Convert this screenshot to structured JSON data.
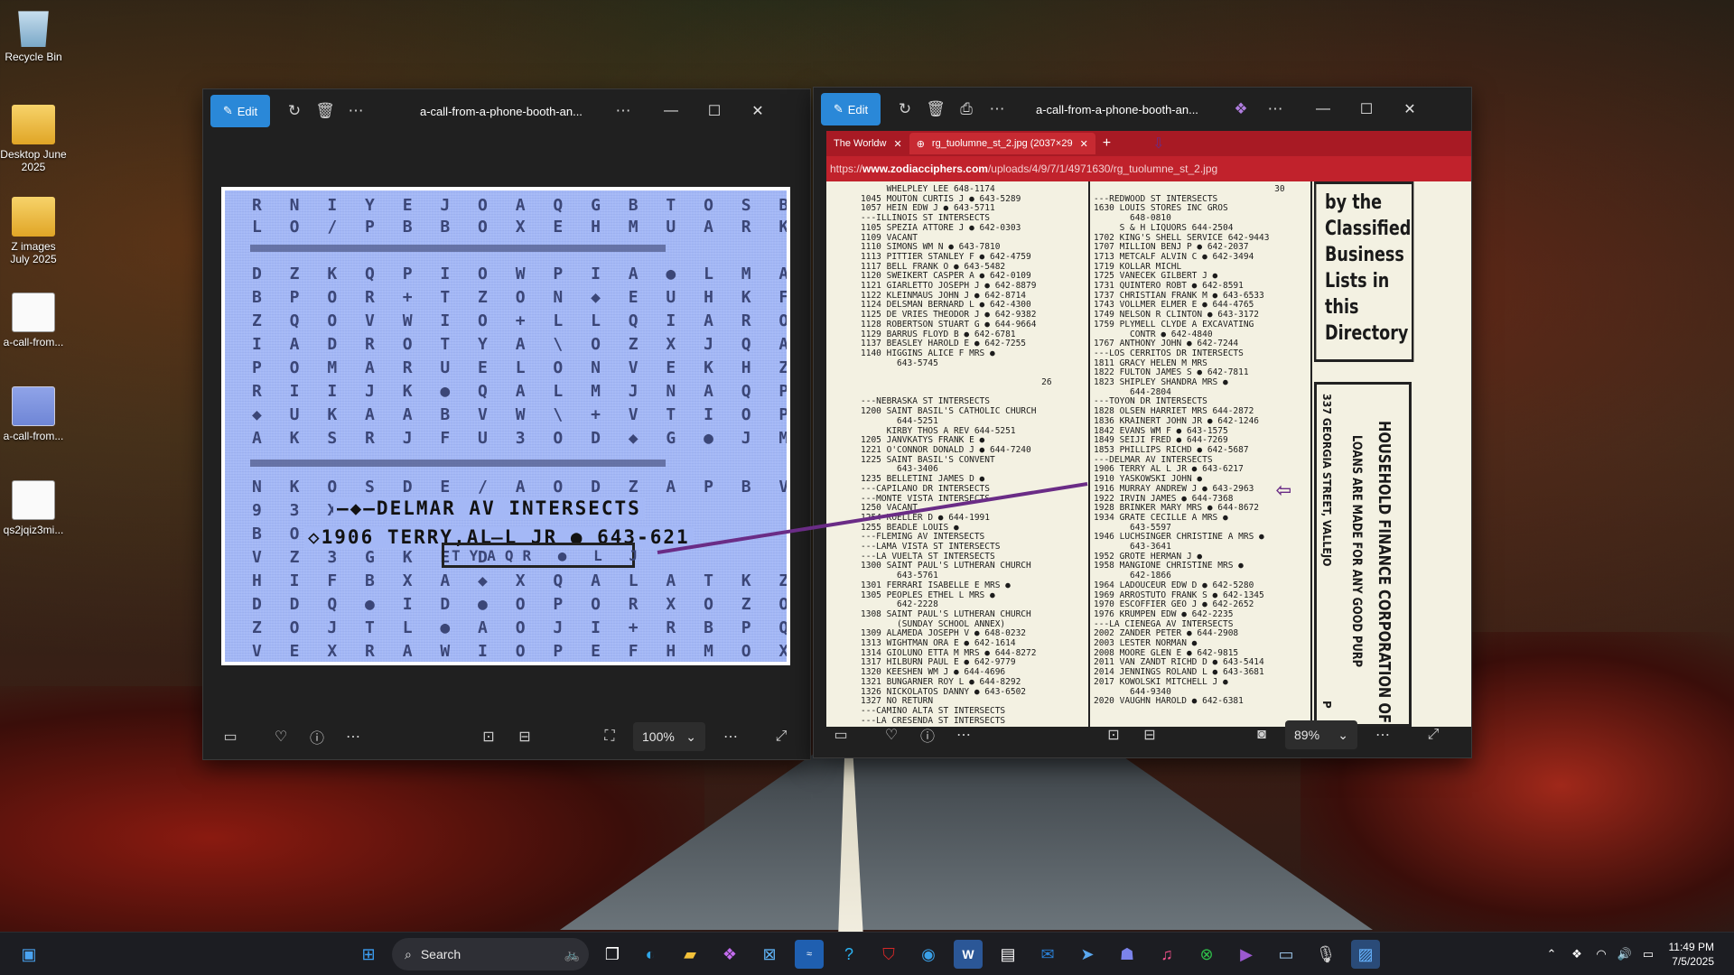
{
  "desktop": {
    "icons": [
      {
        "label": "Recycle Bin"
      },
      {
        "label": "Desktop June 2025"
      },
      {
        "label": "Z images July 2025"
      },
      {
        "label": "a-call-from..."
      },
      {
        "label": "a-call-from..."
      },
      {
        "label": "qs2jqiz3mi..."
      }
    ]
  },
  "left_window": {
    "edit_label": "Edit",
    "title": "a-call-from-a-phone-booth-an...",
    "zoom": "100%",
    "image": {
      "cipher_rows_top": [
        "R N I Y E J O A Q G B T O S B",
        "L O / P B B O X E H M U A R K",
        "D Z K Q P I O W P I A ● L M A A",
        "B P O R + T Z O N ◆ E U H K F",
        "Z Q O V W I O + L L Q I A R O H",
        "I A D R O T Y A \\ O Z X J Q A",
        "P O M A R U E L O N V E K H Z",
        "R I I J K ● Q A L M J N A Q P",
        "◆ U K A A B V W \\ + V T I O P",
        "A K S R J F U 3 O D ◆ G ● J M"
      ],
      "cipher_rows_bottom": [
        "N K O S D E / A O D Z A P B V",
        "9 3 X L",
        "B O T",
        "V Z 3 G K E D",
        "H I F B X A ◆ X Q A L A T K Z",
        "D D Q ● I D ● O P O R X O Z O",
        "Z O J T L ● A O J I + R B P Q W",
        "V E X R A W I O P E F H M O X U I K"
      ],
      "overlay_line_1": "—◆—DELMAR AV INTERSECTS",
      "overlay_line_2": "◇1906 TERRY,AL̶L JR ● 643-621",
      "highlight_text": "TYAQR ● L J"
    }
  },
  "right_window": {
    "edit_label": "Edit",
    "title": "a-call-from-a-phone-booth-an...",
    "zoom": "89%",
    "browser": {
      "tabs": [
        {
          "label": "The Worldw"
        },
        {
          "label": "rg_tuolumne_st_2.jpg (2037×29"
        }
      ],
      "url_prefix": "https://",
      "url_domain": "www.zodiacciphers.com",
      "url_path": "/uploads/4/9/7/1/4971630/rg_tuolumne_st_2.jpg",
      "directory": {
        "col1": "     WHELPLEY LEE 648-1174\n1045 MOUTON CURTIS J ● 643-5289\n1057 HEIN EDW J ● 643-5711\n---ILLINOIS ST INTERSECTS\n1105 SPEZIA ATTORE J ● 642-0303\n1109 VACANT\n1110 SIMONS WM N ● 643-7810\n1113 PITTIER STANLEY F ● 642-4759\n1117 BELL FRANK O ● 643-5482\n1120 SWEIKERT CASPER A ● 642-0109\n1121 GIARLETTO JOSEPH J ● 642-8879\n1122 KLEINMAUS JOHN J ● 642-8714\n1124 DELSMAN BERNARD L ● 642-4300\n1125 DE VRIES THEODOR J ● 642-9382\n1128 ROBERTSON STUART G ● 644-9664\n1129 BARRUS FLOYD B ● 642-6781\n1137 BEASLEY HAROLD E ● 642-7255\n1140 HIGGINS ALICE F MRS ●\n       643-5745\n\n                                   26\n\n---NEBRASKA ST INTERSECTS\n1200 SAINT BASIL'S CATHOLIC CHURCH\n       644-5251\n     KIRBY THOS A REV 644-5251\n1205 JANVKATYS FRANK E ●\n1221 O'CONNOR DONALD J ● 644-7240\n1225 SAINT BASIL'S CONVENT\n       643-3406\n1235 BELLETINI JAMES D ●\n---CAPILANO DR INTERSECTS\n---MONTE VISTA INTERSECTS\n1250 VACANT\n1254 KOELLER D ● 644-1991\n1255 BEADLE LOUIS ●\n---FLEMING AV INTERSECTS\n---LAMA VISTA ST INTERSECTS\n---LA VUELTA ST INTERSECTS\n1300 SAINT PAUL'S LUTHERAN CHURCH\n       643-5761\n1301 FERRARI ISABELLE E MRS ●\n1305 PEOPLES ETHEL L MRS ●\n       642-2228\n1308 SAINT PAUL'S LUTHERAN CHURCH\n       (SUNDAY SCHOOL ANNEX)\n1309 ALAMEDA JOSEPH V ● 648-0232\n1313 WIGHTMAN ORA E ● 642-1614\n1314 GIOLUNO ETTA M MRS ● 644-8272\n1317 HILBURN PAUL E ● 642-9779\n1320 KEESHEN WM J ● 644-4696\n1321 BUNGARNER ROY L ● 644-8292\n1326 NICKOLATOS DANNY ● 643-6502\n1327 NO RETURN\n---CAMINO ALTA ST INTERSECTS\n---LA CRESENDA ST INTERSECTS",
        "col2": "                                   30\n---REDWOOD ST INTERSECTS\n1630 LOUIS STORES INC GROS\n       648-0810\n     S & H LIQUORS 644-2504\n1702 KING'S SHELL SERVICE 642-9443\n1707 MILLION BENJ P ● 642-2037\n1713 METCALF ALVIN C ● 642-3494\n1719 KOLLAR MICHL\n1725 VANECEK GILBERT J ●\n1731 QUINTERO ROBT ● 642-8591\n1737 CHRISTIAN FRANK M ● 643-6533\n1743 VOLLMER ELMER E ● 644-4765\n1749 NELSON R CLINTON ● 643-3172\n1759 PLYMELL CLYDE A EXCAVATING\n       CONTR ● 642-4840\n1767 ANTHONY JOHN ● 642-7244\n---LOS CERRITOS DR INTERSECTS\n1811 GRACY HELEN M MRS\n1822 FULTON JAMES S ● 642-7811\n1823 SHIPLEY SHANDRA MRS ●\n       644-2804\n---TOYON DR INTERSECTS\n1828 OLSEN HARRIET MRS 644-2872\n1836 KRAINERT JOHN JR ● 642-1246\n1842 EVANS WM F ● 643-1575\n1849 SEIJI FRED ● 644-7269\n1853 PHILLIPS RICHD ● 642-5687\n---DELMAR AV INTERSECTS\n1906 TERRY AL L JR ● 643-6217\n1910 YASKOWSKI JOHN ●\n1916 MURRAY ANDREW J ● 643-2963\n1922 IRVIN JAMES ● 644-7368\n1928 BRINKER MARY MRS ● 644-8672\n1934 GRATE CECILLE A MRS ●\n       643-5597\n1946 LUCHSINGER CHRISTINE A MRS ●\n       643-3641\n1952 GROTE HERMAN J ●\n1958 MANGIONE CHRISTINE MRS ●\n       642-1866\n1964 LADOUCEUR EDW D ● 642-5280\n1969 ARROSTUTO FRANK S ● 642-1345\n1970 ESCOFFIER GEO J ● 642-2652\n1976 KRUMPEN EDW ● 642-2235\n---LA CIENEGA AV INTERSECTS\n2002 ZANDER PETER ● 644-2908\n2003 LESTER NORMAN ●\n2008 MOORE GLEN E ● 642-9815\n2011 VAN ZANDT RICHD D ● 643-5414\n2014 JENNINGS ROLAND L ● 643-3681\n2017 KOWOLSKI MITCHELL J ●\n       644-9340\n2020 VAUGHN HAROLD ● 642-6381"
      },
      "ad_top": "by the Classified Business Lists in this Directory",
      "ad_vert_main": "HOUSEHOLD FINANCE CORPORATION OF VA",
      "ad_vert_sub": "LOANS ARE MADE FOR ANY GOOD PURP",
      "ad_vert_addr": "337 GEORGIA STREET, VALLEJO",
      "ad_vert_extra": "P"
    }
  },
  "taskbar": {
    "search_label": "Search",
    "time": "11:49 PM",
    "date": "7/5/2025"
  },
  "colors": {
    "accent": "#2a88d8",
    "annotation_purple": "#6a2c86",
    "browser_tab_red": "#a81a24"
  }
}
